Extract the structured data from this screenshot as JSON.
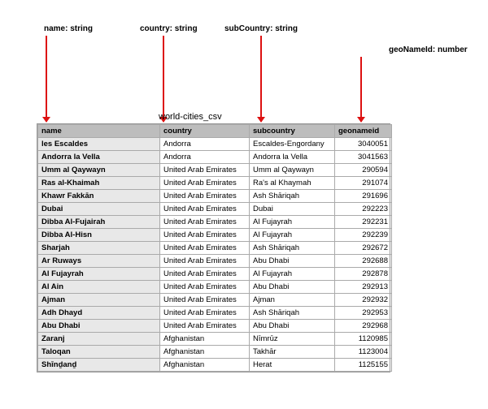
{
  "annotations": {
    "name": "name: string",
    "country": "country: string",
    "subCountry": "subCountry: string",
    "geoNameId": "geoNameId: number"
  },
  "tableTitle": "world-cities_csv",
  "columns": [
    "name",
    "country",
    "subcountry",
    "geonameid"
  ],
  "rows": [
    {
      "name": "les Escaldes",
      "country": "Andorra",
      "subcountry": "Escaldes-Engordany",
      "geonameid": 3040051
    },
    {
      "name": "Andorra la Vella",
      "country": "Andorra",
      "subcountry": "Andorra la Vella",
      "geonameid": 3041563
    },
    {
      "name": "Umm al Qaywayn",
      "country": "United Arab Emirates",
      "subcountry": "Umm al Qaywayn",
      "geonameid": 290594
    },
    {
      "name": "Ras al-Khaimah",
      "country": "United Arab Emirates",
      "subcountry": "Ra's al Khaymah",
      "geonameid": 291074
    },
    {
      "name": "Khawr Fakkān",
      "country": "United Arab Emirates",
      "subcountry": "Ash Shāriqah",
      "geonameid": 291696
    },
    {
      "name": "Dubai",
      "country": "United Arab Emirates",
      "subcountry": "Dubai",
      "geonameid": 292223
    },
    {
      "name": "Dibba Al-Fujairah",
      "country": "United Arab Emirates",
      "subcountry": "Al Fujayrah",
      "geonameid": 292231
    },
    {
      "name": "Dibba Al-Hisn",
      "country": "United Arab Emirates",
      "subcountry": "Al Fujayrah",
      "geonameid": 292239
    },
    {
      "name": "Sharjah",
      "country": "United Arab Emirates",
      "subcountry": "Ash Shāriqah",
      "geonameid": 292672
    },
    {
      "name": "Ar Ruways",
      "country": "United Arab Emirates",
      "subcountry": "Abu Dhabi",
      "geonameid": 292688
    },
    {
      "name": "Al Fujayrah",
      "country": "United Arab Emirates",
      "subcountry": "Al Fujayrah",
      "geonameid": 292878
    },
    {
      "name": "Al Ain",
      "country": "United Arab Emirates",
      "subcountry": "Abu Dhabi",
      "geonameid": 292913
    },
    {
      "name": "Ajman",
      "country": "United Arab Emirates",
      "subcountry": "Ajman",
      "geonameid": 292932
    },
    {
      "name": "Adh Dhayd",
      "country": "United Arab Emirates",
      "subcountry": "Ash Shāriqah",
      "geonameid": 292953
    },
    {
      "name": "Abu Dhabi",
      "country": "United Arab Emirates",
      "subcountry": "Abu Dhabi",
      "geonameid": 292968
    },
    {
      "name": "Zaranj",
      "country": "Afghanistan",
      "subcountry": "Nīmrūz",
      "geonameid": 1120985
    },
    {
      "name": "Taloqan",
      "country": "Afghanistan",
      "subcountry": "Takhār",
      "geonameid": 1123004
    },
    {
      "name": "Shīnḏanḏ",
      "country": "Afghanistan",
      "subcountry": "Herat",
      "geonameid": 1125155
    }
  ]
}
